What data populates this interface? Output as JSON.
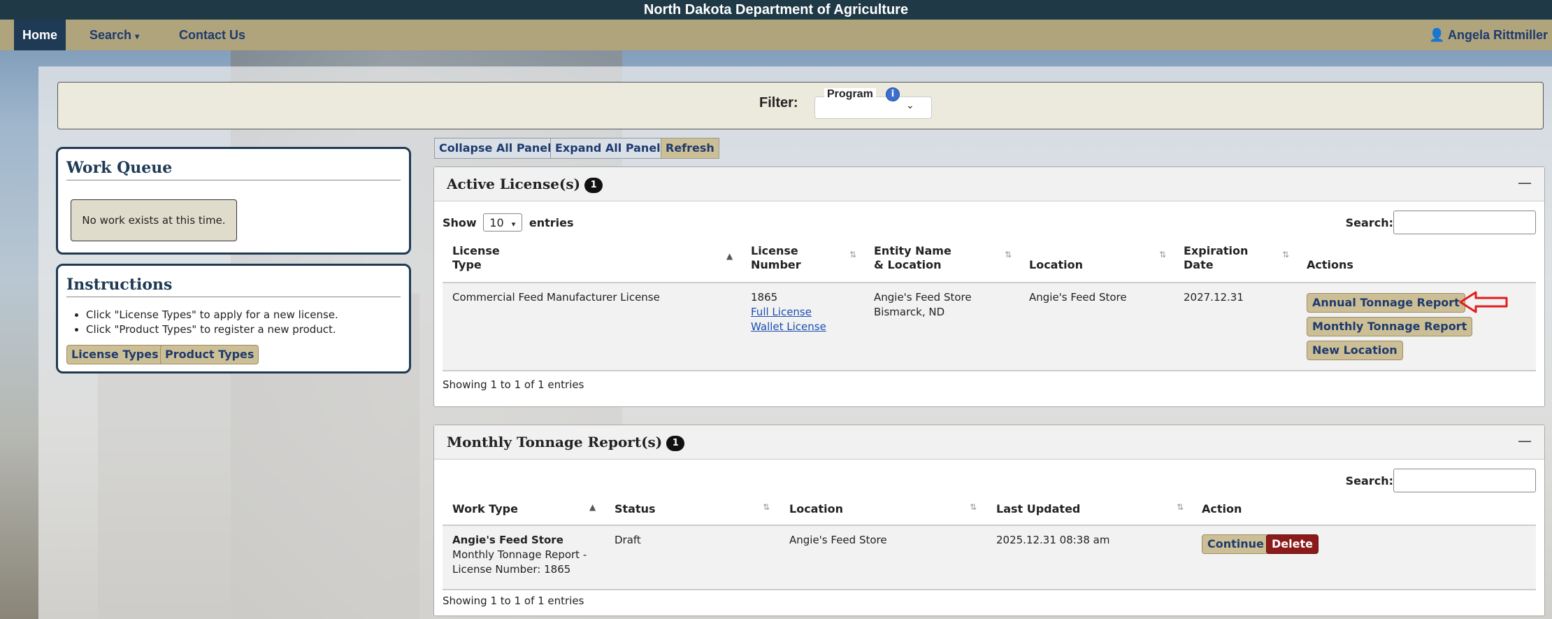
{
  "header": {
    "title": "North Dakota Department of Agriculture"
  },
  "nav": {
    "home": "Home",
    "search": "Search",
    "contact": "Contact Us",
    "user": "Angela Rittmiller"
  },
  "filter": {
    "label": "Filter:",
    "program_label": "Program",
    "program_value": ""
  },
  "work_queue": {
    "title": "Work Queue",
    "empty": "No work exists at this time."
  },
  "instructions": {
    "title": "Instructions",
    "items": [
      "Click \"License Types\" to apply for a new license.",
      "Click \"Product Types\" to register a new product."
    ],
    "license_types": "License Types",
    "product_types": "Product Types"
  },
  "toolbar": {
    "collapse": "Collapse All Panels",
    "expand": "Expand All Panels",
    "refresh": "Refresh"
  },
  "licenses": {
    "title": "Active License(s)",
    "count": "1",
    "show": "Show",
    "entries_value": "10",
    "entries": "entries",
    "search_label": "Search:",
    "headers": {
      "type_1": "License",
      "type_2": "Type",
      "number_1": "License",
      "number_2": "Number",
      "entity_1": "Entity Name",
      "entity_2": "& Location",
      "location": "Location",
      "exp_1": "Expiration",
      "exp_2": "Date",
      "actions": "Actions"
    },
    "row": {
      "type": "Commercial Feed Manufacturer License",
      "number": "1865",
      "full_license": "Full License",
      "wallet_license": "Wallet License",
      "entity_name": "Angie's Feed Store",
      "entity_city": "Bismarck, ND",
      "location": "Angie's Feed Store",
      "expiration": "2027.12.31",
      "btn_annual": "Annual Tonnage Report",
      "btn_monthly": "Monthly Tonnage Report",
      "btn_new_location": "New Location"
    },
    "showing": "Showing 1 to 1 of 1 entries"
  },
  "monthly": {
    "title": "Monthly Tonnage Report(s)",
    "count": "1",
    "search_label": "Search:",
    "headers": {
      "work_type": "Work Type",
      "status": "Status",
      "location": "Location",
      "last_updated": "Last Updated",
      "action": "Action"
    },
    "row": {
      "name": "Angie's Feed Store",
      "desc_1": "Monthly Tonnage Report -",
      "desc_2": "License Number: 1865",
      "status": "Draft",
      "location": "Angie's Feed Store",
      "last_updated": "2025.12.31 08:38 am",
      "btn_continue": "Continue",
      "btn_delete": "Delete"
    },
    "showing": "Showing 1 to 1 of 1 entries"
  },
  "colors": {
    "nav_bg": "#b0a47c",
    "header_bg": "#1f3a46",
    "button_bg": "#cdbf95",
    "delete_bg": "#8b1a1a",
    "annotation_arrow": "#e01e1e"
  }
}
